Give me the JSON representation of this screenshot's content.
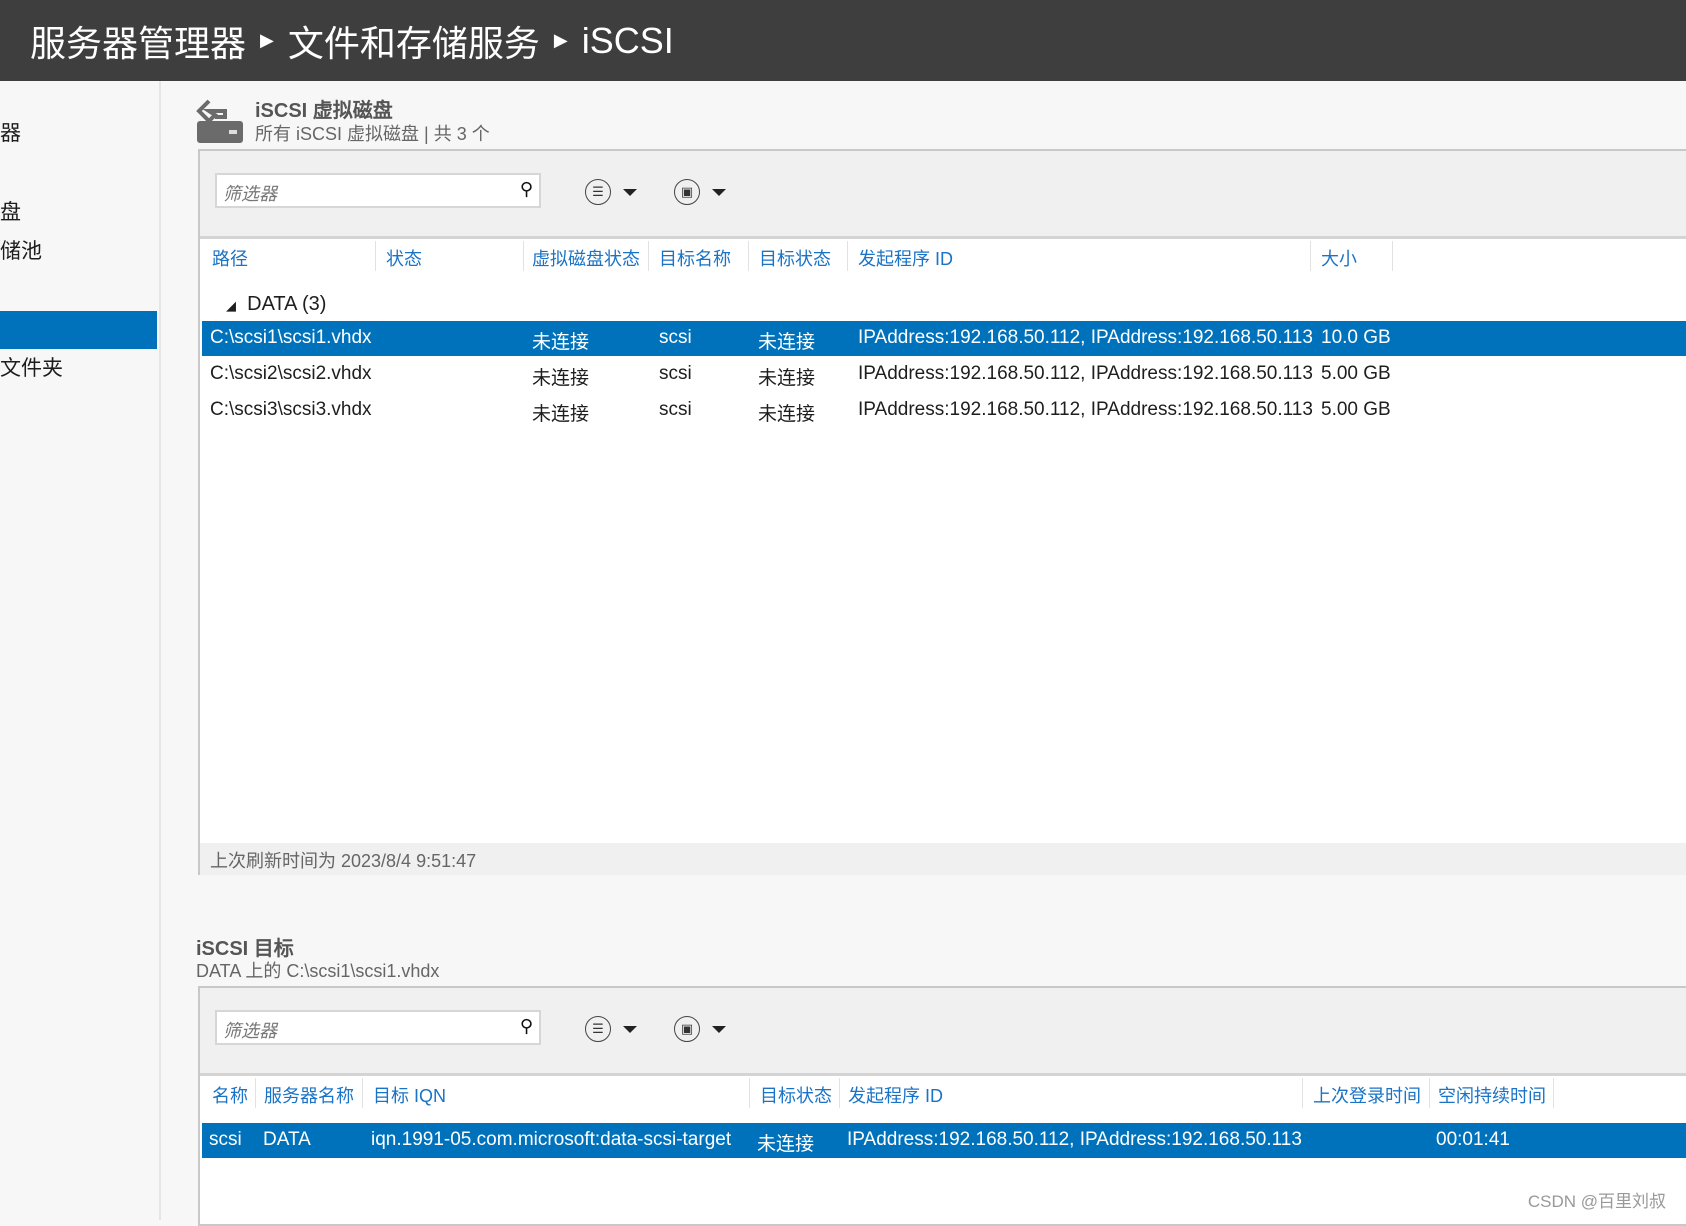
{
  "breadcrumb": [
    "服务器管理器",
    "文件和存储服务",
    "iSCSI"
  ],
  "sidebar": {
    "items": [
      {
        "label": "器"
      },
      {
        "label": "盘"
      },
      {
        "label": "储池"
      },
      {
        "label": ""
      },
      {
        "label": "文件夹"
      }
    ],
    "selected_index": 3
  },
  "disks": {
    "title": "iSCSI 虚拟磁盘",
    "subtitle": "所有 iSCSI 虚拟磁盘 | 共 3 个",
    "filter_placeholder": "筛选器",
    "columns": [
      "路径",
      "状态",
      "虚拟磁盘状态",
      "目标名称",
      "目标状态",
      "发起程序 ID",
      "大小"
    ],
    "group": "DATA (3)",
    "rows": [
      {
        "path": "C:\\scsi1\\scsi1.vhdx",
        "disk_status": "未连接",
        "target": "scsi",
        "target_status": "未连接",
        "initiator": "IPAddress:192.168.50.112, IPAddress:192.168.50.113",
        "size": "10.0 GB",
        "selected": true
      },
      {
        "path": "C:\\scsi2\\scsi2.vhdx",
        "disk_status": "未连接",
        "target": "scsi",
        "target_status": "未连接",
        "initiator": "IPAddress:192.168.50.112, IPAddress:192.168.50.113",
        "size": "5.00 GB"
      },
      {
        "path": "C:\\scsi3\\scsi3.vhdx",
        "disk_status": "未连接",
        "target": "scsi",
        "target_status": "未连接",
        "initiator": "IPAddress:192.168.50.112, IPAddress:192.168.50.113",
        "size": "5.00 GB"
      }
    ],
    "footer": "上次刷新时间为 2023/8/4 9:51:47"
  },
  "targets": {
    "title": "iSCSI 目标",
    "subtitle": "DATA 上的 C:\\scsi1\\scsi1.vhdx",
    "filter_placeholder": "筛选器",
    "columns": [
      "名称",
      "服务器名称",
      "目标 IQN",
      "目标状态",
      "发起程序 ID",
      "上次登录时间",
      "空闲持续时间"
    ],
    "rows": [
      {
        "name": "scsi",
        "server": "DATA",
        "iqn": "iqn.1991-05.com.microsoft:data-scsi-target",
        "status": "未连接",
        "initiator": "IPAddress:192.168.50.112, IPAddress:192.168.50.113",
        "last_login": "",
        "idle": "00:01:41",
        "selected": true
      }
    ]
  },
  "watermark": "CSDN @百里刘叔",
  "colors": {
    "accent": "#0072bc",
    "titlebar": "#3e3e3e",
    "header_text": "#1a73c6"
  }
}
